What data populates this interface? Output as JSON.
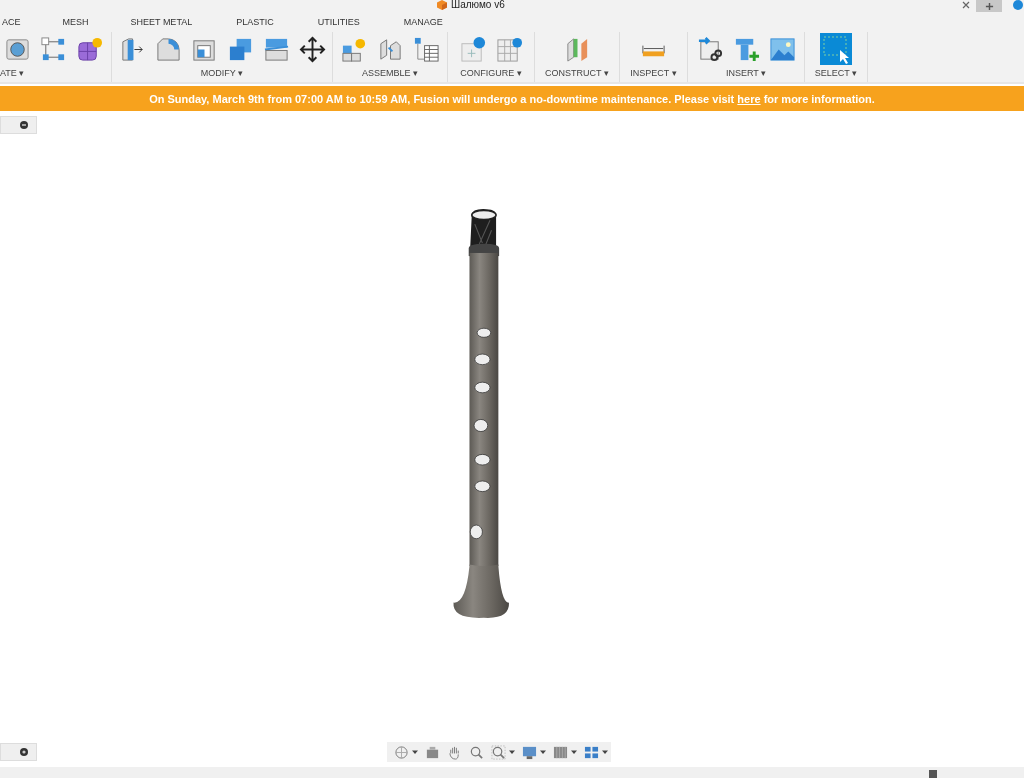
{
  "window": {
    "title": "Шалюмо v6"
  },
  "tabs": [
    {
      "label": "ACE",
      "selected": false
    },
    {
      "label": "MESH",
      "selected": false
    },
    {
      "label": "SHEET METAL",
      "selected": false
    },
    {
      "label": "PLASTIC",
      "selected": false
    },
    {
      "label": "UTILITIES",
      "selected": false
    },
    {
      "label": "MANAGE",
      "selected": false
    }
  ],
  "toolbar_groups": [
    {
      "label": "ATE ▾",
      "kind": "create"
    },
    {
      "label": "MODIFY ▾",
      "kind": "modify"
    },
    {
      "label": "ASSEMBLE ▾",
      "kind": "assemble"
    },
    {
      "label": "CONFIGURE ▾",
      "kind": "configure"
    },
    {
      "label": "CONSTRUCT ▾",
      "kind": "construct"
    },
    {
      "label": "INSPECT ▾",
      "kind": "inspect"
    },
    {
      "label": "INSERT ▾",
      "kind": "insert"
    },
    {
      "label": "SELECT ▾",
      "kind": "select"
    }
  ],
  "banner": {
    "text_before": "On Sunday, March 9th from 07:00 AM to 10:59 AM, Fusion will undergo a no-downtime maintenance. Please visit ",
    "link": "here",
    "text_after": " for more information."
  }
}
